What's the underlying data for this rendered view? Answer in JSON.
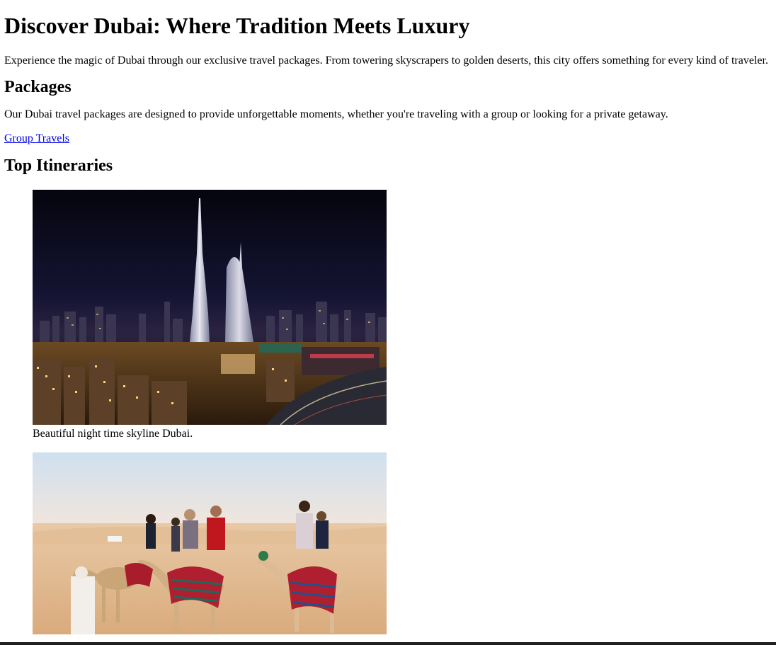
{
  "header": {
    "title": "Discover Dubai: Where Tradition Meets Luxury",
    "intro": "Experience the magic of Dubai through our exclusive travel packages. From towering skyscrapers to golden deserts, this city offers something for every kind of traveler."
  },
  "packages": {
    "heading": "Packages",
    "text": "Our Dubai travel packages are designed to provide unforgettable moments, whether you're traveling with a group or looking for a private getaway.",
    "link_label": "Group Travels"
  },
  "itineraries": {
    "heading": "Top Itineraries",
    "items": [
      {
        "caption": "Beautiful night time skyline Dubai."
      },
      {
        "caption": ""
      }
    ]
  },
  "colors": {
    "link": "#0000ee",
    "text": "#000000",
    "background": "#ffffff"
  }
}
